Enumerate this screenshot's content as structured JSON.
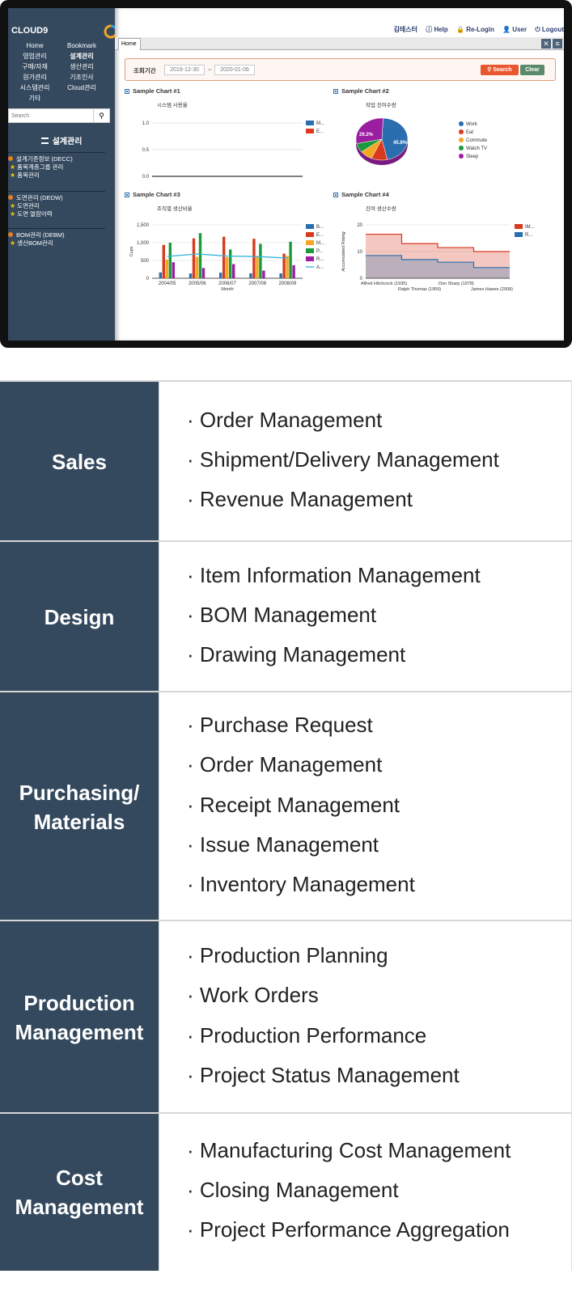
{
  "screenshot": {
    "brand": "CLOUD9",
    "topnav": [
      {
        "left": "Home",
        "right": "Bookmark"
      },
      {
        "left": "영업관리",
        "right": "설계관리"
      },
      {
        "left": "구매/자재",
        "right": "생산관리"
      },
      {
        "left": "원가관리",
        "right": "기조인사"
      },
      {
        "left": "시스템관리",
        "right": "Cloud관리"
      },
      {
        "left": "기타",
        "right": ""
      }
    ],
    "search_placeholder": "Search",
    "menu_title": "설계관리",
    "menu_groups": [
      {
        "title": "설계기준정보 (DECC)",
        "items": [
          "품목계층그룹 관리",
          "품목관리"
        ]
      },
      {
        "title": "도면관리 (DEDW)",
        "items": [
          "도면관리",
          "도면 열람이력"
        ]
      },
      {
        "title": "BOM관리 (DEBM)",
        "items": [
          "생산BOM관리"
        ]
      }
    ],
    "userbar": {
      "user_name": "김테스터",
      "help": "Help",
      "relogin": "Re-Login",
      "user": "User",
      "logout": "Logout"
    },
    "tab_label": "Home",
    "filter": {
      "label": "조회기간",
      "date_from": "2019-12-30",
      "tilde": "~",
      "date_to": "2020-01-06",
      "search": "Search",
      "clear": "Clear"
    },
    "charts": {
      "c1_title": "Sample Chart #1",
      "c2_title": "Sample Chart #2",
      "c3_title": "Sample Chart #3",
      "c4_title": "Sample Chart #4"
    }
  },
  "chart_data": [
    {
      "type": "line",
      "title": "시스템 사용율",
      "ylim": [
        0,
        1
      ],
      "yticks": [
        "1.0",
        "0.5",
        "0.0"
      ],
      "series": [
        {
          "name": "M...",
          "color": "#2a6eb0"
        },
        {
          "name": "E...",
          "color": "#d9391f"
        }
      ]
    },
    {
      "type": "pie",
      "title": "작업 진여수량",
      "slices": [
        {
          "name": "Work",
          "value": 45.8,
          "color": "#2a6eb0"
        },
        {
          "name": "Eat",
          "value": 10,
          "color": "#d9391f"
        },
        {
          "name": "Commute",
          "value": 8,
          "color": "#f5a623"
        },
        {
          "name": "Watch TV",
          "value": 7,
          "color": "#1b9a3a"
        },
        {
          "name": "Sleep",
          "value": 29.2,
          "color": "#9b1da0"
        }
      ],
      "labels": [
        "45.8%",
        "29.2%"
      ]
    },
    {
      "type": "bar",
      "title": "조직별 생산비율",
      "xlabel": "Month",
      "ylabel": "Cups",
      "categories": [
        "2004/05",
        "2005/06",
        "2006/07",
        "2007/08",
        "2008/09"
      ],
      "yticks": [
        "1,500",
        "1,000",
        "500",
        "0"
      ],
      "ylim": [
        0,
        1500
      ],
      "series": [
        {
          "name": "B...",
          "color": "#2a6eb0",
          "values": [
            165,
            135,
            157,
            139,
            136
          ]
        },
        {
          "name": "E...",
          "color": "#d9391f",
          "values": [
            938,
            1120,
            1167,
            1110,
            691
          ]
        },
        {
          "name": "M...",
          "color": "#f5a623",
          "values": [
            522,
            599,
            587,
            615,
            629
          ]
        },
        {
          "name": "P...",
          "color": "#1b9a3a",
          "values": [
            998,
            1268,
            807,
            968,
            1026
          ]
        },
        {
          "name": "R...",
          "color": "#9b1da0",
          "values": [
            450,
            288,
            397,
            215,
            366
          ]
        }
      ],
      "line": {
        "name": "A...",
        "color": "#2fb5d5",
        "values": [
          614,
          682,
          623,
          609,
          569
        ]
      }
    },
    {
      "type": "area",
      "title": "진여 생산수량",
      "ylabel": "Accumulated Rating",
      "yticks": [
        "20",
        "10",
        "0"
      ],
      "ylim": [
        0,
        20
      ],
      "xlabels": [
        "Alfred Hitchcock (1935)",
        "Ralph Thomas (1959)",
        "Don Sharp (1978)",
        "James Hawes (2008)"
      ],
      "series": [
        {
          "name": "IM...",
          "color": "#d9391f",
          "values": [
            16.5,
            13,
            11.5,
            10
          ]
        },
        {
          "name": "R...",
          "color": "#2a6eb0",
          "values": [
            8.5,
            7,
            6,
            4
          ]
        }
      ]
    }
  ],
  "features": [
    {
      "category": "Sales",
      "items": [
        "· Order Management",
        "· Shipment/Delivery Management",
        "· Revenue Management"
      ]
    },
    {
      "category": "Design",
      "items": [
        "· Item Information Management",
        "· BOM Management",
        "· Drawing Management"
      ]
    },
    {
      "category": "Purchasing/\nMaterials",
      "items": [
        "· Purchase Request",
        "· Order Management",
        "· Receipt Management",
        "· Issue Management",
        "· Inventory Management"
      ]
    },
    {
      "category": "Production\nManagement",
      "items": [
        "· Production Planning",
        "· Work Orders",
        "· Production Performance",
        "· Project Status Management"
      ]
    },
    {
      "category": "Cost\nManagement",
      "items": [
        "· Manufacturing Cost Management",
        "· Closing Management",
        "· Project Performance Aggregation"
      ]
    }
  ]
}
